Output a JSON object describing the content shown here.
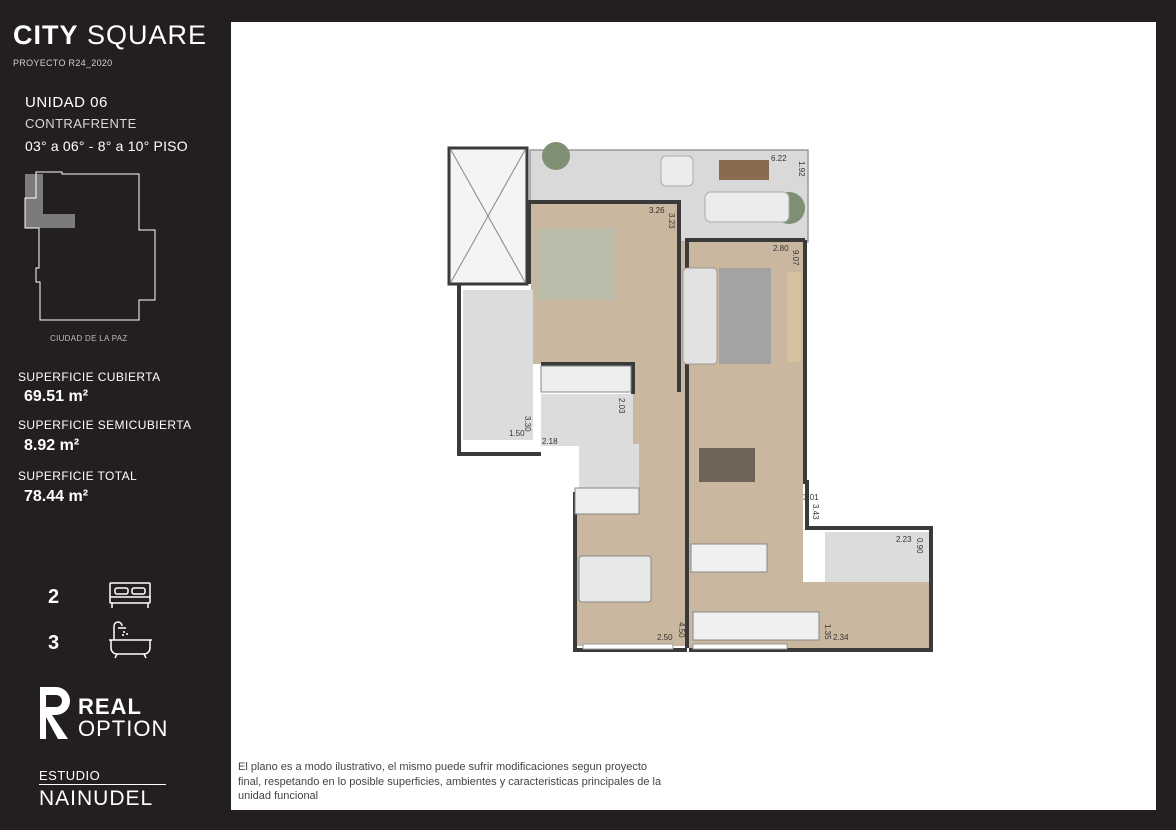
{
  "brand": {
    "bold": "CITY",
    "light": "SQUARE",
    "project": "PROYECTO R24_2020"
  },
  "unit": {
    "name": "UNIDAD 06",
    "orientation": "CONTRAFRENTE",
    "floors": "03° a 06° - 8° a 10° PISO"
  },
  "keyplan": {
    "street": "CIUDAD DE LA PAZ"
  },
  "areas": {
    "covered_label": "SUPERFICIE CUBIERTA",
    "covered_value": "69.51 m²",
    "semi_label": "SUPERFICIE SEMICUBIERTA",
    "semi_value": "8.92 m²",
    "total_label": "SUPERFICIE TOTAL",
    "total_value": "78.44 m²"
  },
  "rooms": {
    "bedrooms": "2",
    "bedroom_icon": "bed-icon",
    "bathrooms": "3",
    "bathroom_icon": "bathtub-icon"
  },
  "logos": {
    "real_top": "REAL",
    "real_bottom": "OPTION",
    "studio": "ESTUDIO",
    "studio_name": "NAINUDEL"
  },
  "dimensions": [
    "6.22",
    "1.92",
    "3.26",
    "3.23",
    "2.80",
    "9.07",
    "3.30",
    "1.50",
    "2.03",
    "2.18",
    "3.01",
    "3.43",
    "2.23",
    "0.90",
    "2.50",
    "4.50",
    "1.35",
    "2.34"
  ],
  "disclaimer": "El plano es a modo ilustrativo, el mismo puede sufrir modificaciones segun proyecto final, respetando en lo posible superficies, ambientes y caracteristicas principales de la unidad funcional",
  "colors": {
    "background": "#231f20",
    "wood_floor": "#c9b89f",
    "tile_floor": "#dcdcdc",
    "wall": "#3a3a3a"
  }
}
